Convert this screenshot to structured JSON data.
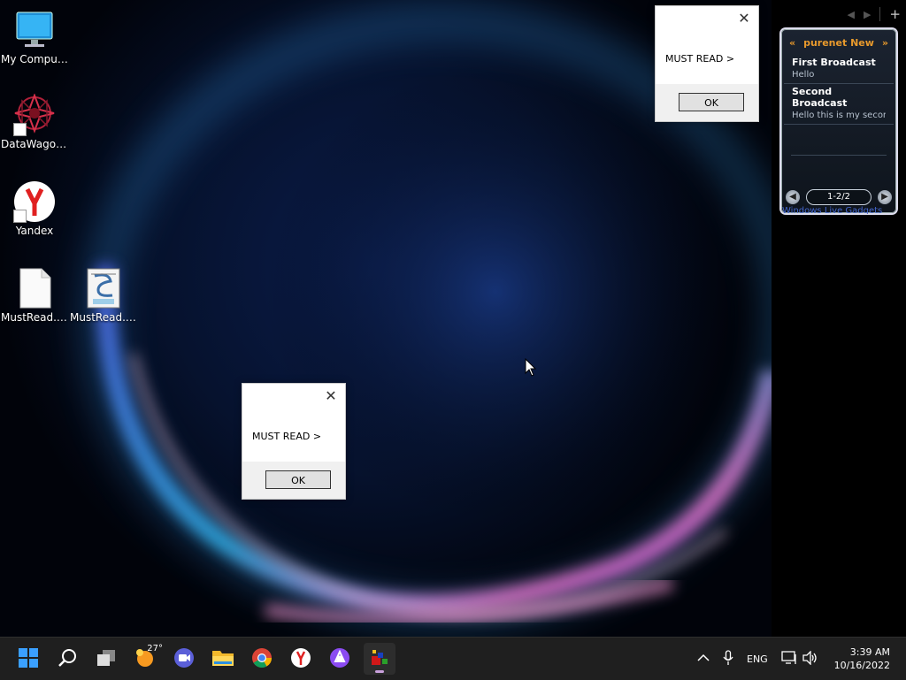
{
  "desktop": {
    "icons": [
      {
        "label": "My Computer",
        "icon": "computer-monitor-icon"
      },
      {
        "label": "DataWagon...",
        "icon": "datawagon-icon"
      },
      {
        "label": "Yandex",
        "icon": "yandex-browser-icon"
      },
      {
        "label": "MustRead.v...",
        "icon": "blank-file-icon"
      },
      {
        "label": "MustRead.vbs",
        "icon": "vbs-script-icon"
      }
    ]
  },
  "dialogs": [
    {
      "message": "MUST READ >",
      "ok_label": "OK"
    },
    {
      "message": "MUST READ >",
      "ok_label": "OK"
    }
  ],
  "gadget": {
    "title": "purenet New",
    "prev_symbol": "«",
    "next_symbol": "»",
    "items": [
      {
        "title": "First Broadcast",
        "body": "Hello"
      },
      {
        "title": "Second Broadcast",
        "body": "Hello this is my second"
      }
    ],
    "pager": "1-2/2",
    "caption": "Windows Live Gadgets"
  },
  "taskbar": {
    "apps": [
      {
        "name": "start",
        "icon": "windows-start-icon"
      },
      {
        "name": "search",
        "icon": "search-icon"
      },
      {
        "name": "task-view",
        "icon": "task-view-icon"
      },
      {
        "name": "weather",
        "icon": "weather-icon",
        "badge": "27°"
      },
      {
        "name": "meet",
        "icon": "video-call-icon"
      },
      {
        "name": "file-explorer",
        "icon": "folder-icon"
      },
      {
        "name": "chrome",
        "icon": "chrome-icon"
      },
      {
        "name": "yandex",
        "icon": "yandex-browser-icon"
      },
      {
        "name": "alice",
        "icon": "alice-assistant-icon"
      },
      {
        "name": "gadgets",
        "icon": "gadgets-app-icon",
        "active": true
      }
    ],
    "tray": {
      "language": "ENG",
      "time": "3:39 AM",
      "date": "10/16/2022"
    }
  },
  "colors": {
    "taskbar": "#1f1f1f",
    "gadget_title": "#e89a2c",
    "active_indicator": "#c9a0dc"
  }
}
